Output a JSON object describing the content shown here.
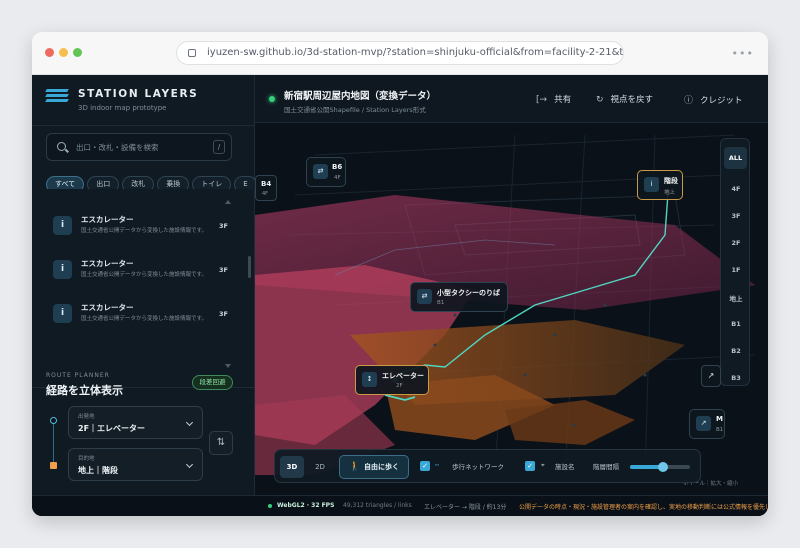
{
  "browser": {
    "url": "iyuzen-sw.github.io/3d-station-mvp/?station=shinjuku-official&from=facility-2-21&to=faci...",
    "menu": "•••"
  },
  "brand": {
    "title": "STATION LAYERS",
    "subtitle": "3D indoor map prototype"
  },
  "search": {
    "placeholder": "出口・改札・設備を検索",
    "shortcut": "/"
  },
  "filters": [
    {
      "label": "すべて",
      "active": true
    },
    {
      "label": "出口",
      "active": false
    },
    {
      "label": "改札",
      "active": false
    },
    {
      "label": "乗換",
      "active": false
    },
    {
      "label": "トイレ",
      "active": false
    },
    {
      "label": "E",
      "active": false
    }
  ],
  "facilities": [
    {
      "icon": "i",
      "name": "エスカレーター",
      "desc": "国土交通省公開データから変換した施設情報です。",
      "floor": "3F"
    },
    {
      "icon": "i",
      "name": "エスカレーター",
      "desc": "国土交通省公開データから変換した施設情報です。",
      "floor": "3F"
    },
    {
      "icon": "i",
      "name": "エスカレーター",
      "desc": "国土交通省公開データから変換した施設情報です。",
      "floor": "3F"
    }
  ],
  "route": {
    "kicker": "ROUTE PLANNER",
    "title": "経路を立体表示",
    "badge": "段差回避",
    "from": {
      "label": "出発地",
      "value": "2F｜エレベーター"
    },
    "to": {
      "label": "目的地",
      "value": "地上｜階段"
    },
    "swap_icon": "⇅"
  },
  "view": {
    "title": "新宿駅周辺屋内地図（変換データ）",
    "subtitle": "国土交通省公開Shapefile / Station Layers形式",
    "actions": [
      {
        "icon": "[→",
        "label": "共有"
      },
      {
        "icon": "↻",
        "label": "視点を戻す"
      },
      {
        "icon": "ⓘ",
        "label": "クレジット"
      }
    ]
  },
  "floors": [
    "ALL",
    "4F",
    "3F",
    "2F",
    "1F",
    "地上",
    "B1",
    "B2",
    "B3"
  ],
  "active_floor": "ALL",
  "markers": [
    {
      "icon": "⇄",
      "name": "B6",
      "floor": "4F"
    },
    {
      "icon": "i",
      "name": "階段",
      "floor": "地上"
    },
    {
      "icon": "⇄",
      "name": "小型タクシーのりば",
      "floor": "B1"
    },
    {
      "icon": "↕",
      "name": "エレベーター",
      "floor": "2F"
    },
    {
      "icon": "↗",
      "name": "M",
      "floor": "B1"
    }
  ],
  "floor_tag_b4": {
    "name": "B4",
    "floor": "4F"
  },
  "controls": {
    "mode_3d": "3D",
    "mode_2d": "2D",
    "active_mode": "3D",
    "walk": "自由に歩く",
    "walk_icon": "🚶",
    "network_label": "歩行ネットワーク",
    "network_checked": true,
    "facility_label": "施設名",
    "facility_checked": true,
    "spacing_label": "階層間隔",
    "spacing_value": 0.55
  },
  "legend": {
    "text": "ホイール｜拡大・縮小"
  },
  "status": {
    "webgl": "WebGL2 · 32 FPS",
    "tris": "49,312 triangles / links",
    "route": "エレベーター → 階段 / 約13分",
    "notice": "公開データの時点・現況・施設管理者の案内を確認し、実地の移動判断には公式情報を優先してください。"
  },
  "colors": {
    "accent": "#3aa8d6",
    "live": "#35d07f",
    "route": "#4fd6c0",
    "warn": "#f0a04a"
  }
}
